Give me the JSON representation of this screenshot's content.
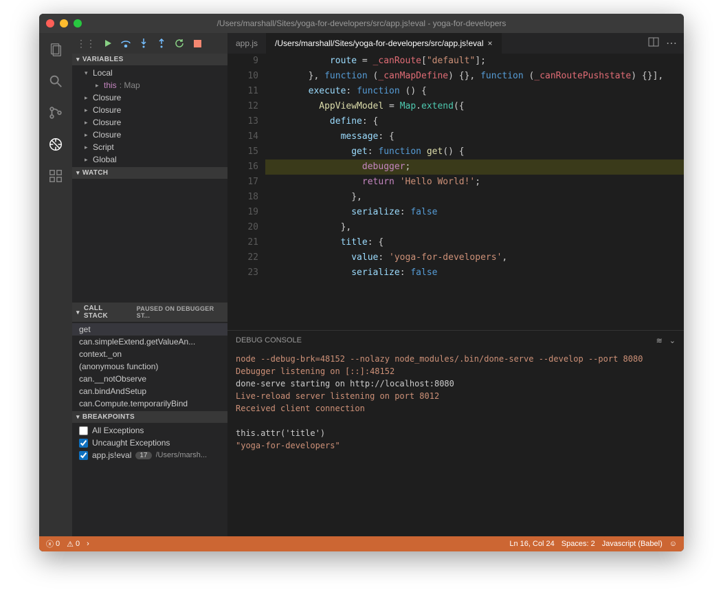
{
  "window_title": "/Users/marshall/Sites/yoga-for-developers/src/app.js!eval - yoga-for-developers",
  "tabs": [
    {
      "label": "app.js",
      "active": false
    },
    {
      "label": "/Users/marshall/Sites/yoga-for-developers/src/app.js!eval",
      "active": true
    }
  ],
  "debug_sections": {
    "variables": {
      "title": "VARIABLES",
      "scopes": [
        {
          "name": "Local",
          "expanded": true,
          "children": [
            {
              "name": "this",
              "type": "Map"
            }
          ]
        },
        {
          "name": "Closure",
          "expanded": false
        },
        {
          "name": "Closure",
          "expanded": false
        },
        {
          "name": "Closure",
          "expanded": false
        },
        {
          "name": "Closure",
          "expanded": false
        },
        {
          "name": "Script",
          "expanded": false
        },
        {
          "name": "Global",
          "expanded": false
        }
      ]
    },
    "watch": {
      "title": "WATCH"
    },
    "callstack": {
      "title": "CALL STACK",
      "status": "PAUSED ON DEBUGGER ST...",
      "frames": [
        "get",
        "can.simpleExtend.getValueAn...",
        "context._on",
        "(anonymous function)",
        "can.__notObserve",
        "can.bindAndSetup",
        "can.Compute.temporarilyBind"
      ],
      "selected": 0
    },
    "breakpoints": {
      "title": "BREAKPOINTS",
      "all_exceptions": {
        "label": "All Exceptions",
        "checked": false
      },
      "uncaught_exceptions": {
        "label": "Uncaught Exceptions",
        "checked": true
      },
      "items": [
        {
          "label": "app.js!eval",
          "line": 17,
          "path": "/Users/marsh...",
          "checked": true
        }
      ]
    }
  },
  "editor": {
    "lines": [
      9,
      10,
      11,
      12,
      13,
      14,
      15,
      16,
      17,
      18,
      19,
      20,
      21,
      22,
      23
    ],
    "highlight_line": 16,
    "breakpoint_yellow": 16,
    "breakpoint_red": 17,
    "code": {
      "9": [
        [
          "            ",
          "plain"
        ],
        [
          "route",
          "prop"
        ],
        [
          " = ",
          "plain"
        ],
        [
          "_canRoute",
          "param"
        ],
        [
          "[",
          "plain"
        ],
        [
          "\"default\"",
          "string"
        ],
        [
          "];",
          "plain"
        ]
      ],
      "10": [
        [
          "        }, ",
          "plain"
        ],
        [
          "function",
          "func"
        ],
        [
          " (",
          "plain"
        ],
        [
          "_canMapDefine",
          "param"
        ],
        [
          ") {}, ",
          "plain"
        ],
        [
          "function",
          "func"
        ],
        [
          " (",
          "plain"
        ],
        [
          "_canRoutePushstate",
          "param"
        ],
        [
          ") {}],",
          "plain"
        ]
      ],
      "11": [
        [
          "        ",
          "plain"
        ],
        [
          "execute",
          "prop"
        ],
        [
          ": ",
          "plain"
        ],
        [
          "function",
          "func"
        ],
        [
          " () {",
          "plain"
        ]
      ],
      "12": [
        [
          "          ",
          "plain"
        ],
        [
          "AppViewModel",
          "name"
        ],
        [
          " = ",
          "plain"
        ],
        [
          "Map",
          "ext"
        ],
        [
          ".",
          "plain"
        ],
        [
          "extend",
          "ext"
        ],
        [
          "({",
          "plain"
        ]
      ],
      "13": [
        [
          "            ",
          "plain"
        ],
        [
          "define",
          "prop"
        ],
        [
          ": {",
          "plain"
        ]
      ],
      "14": [
        [
          "              ",
          "plain"
        ],
        [
          "message",
          "prop"
        ],
        [
          ": {",
          "plain"
        ]
      ],
      "15": [
        [
          "                ",
          "plain"
        ],
        [
          "get",
          "prop"
        ],
        [
          ": ",
          "plain"
        ],
        [
          "function",
          "func"
        ],
        [
          " ",
          "plain"
        ],
        [
          "get",
          "name"
        ],
        [
          "() {",
          "plain"
        ]
      ],
      "16": [
        [
          "                  ",
          "plain"
        ],
        [
          "debugger",
          "debugger"
        ],
        [
          ";",
          "plain"
        ]
      ],
      "17": [
        [
          "                  ",
          "plain"
        ],
        [
          "return",
          "keyword"
        ],
        [
          " ",
          "plain"
        ],
        [
          "'Hello World!'",
          "string"
        ],
        [
          ";",
          "plain"
        ]
      ],
      "18": [
        [
          "                },",
          "plain"
        ]
      ],
      "19": [
        [
          "                ",
          "plain"
        ],
        [
          "serialize",
          "prop"
        ],
        [
          ": ",
          "plain"
        ],
        [
          "false",
          "bool"
        ]
      ],
      "20": [
        [
          "              },",
          "plain"
        ]
      ],
      "21": [
        [
          "              ",
          "plain"
        ],
        [
          "title",
          "prop"
        ],
        [
          ": {",
          "plain"
        ]
      ],
      "22": [
        [
          "                ",
          "plain"
        ],
        [
          "value",
          "prop"
        ],
        [
          ": ",
          "plain"
        ],
        [
          "'yoga-for-developers'",
          "string"
        ],
        [
          ",",
          "plain"
        ]
      ],
      "23": [
        [
          "                ",
          "plain"
        ],
        [
          "serialize",
          "prop"
        ],
        [
          ": ",
          "plain"
        ],
        [
          "false",
          "bool"
        ]
      ]
    }
  },
  "debug_console": {
    "title": "DEBUG CONSOLE",
    "lines": [
      {
        "text": "node --debug-brk=48152 --nolazy node_modules/.bin/done-serve --develop --port 8080",
        "cls": "con-cmd"
      },
      {
        "text": "Debugger listening on [::]:48152",
        "cls": "con-warn"
      },
      {
        "text": "done-serve starting on http://localhost:8080",
        "cls": "con-text"
      },
      {
        "text": "Live-reload server listening on port 8012",
        "cls": "con-warn"
      },
      {
        "text": "Received client connection",
        "cls": "con-warn"
      },
      {
        "text": "",
        "cls": "con-text"
      },
      {
        "text": "this.attr('title')",
        "cls": "con-text"
      },
      {
        "text": "\"yoga-for-developers\"",
        "cls": "con-str"
      }
    ]
  },
  "statusbar": {
    "errors": 0,
    "warnings": 0,
    "breadcrumb": "›",
    "line_col": "Ln 16, Col 24",
    "spaces": "Spaces: 2",
    "language": "Javascript (Babel)"
  }
}
